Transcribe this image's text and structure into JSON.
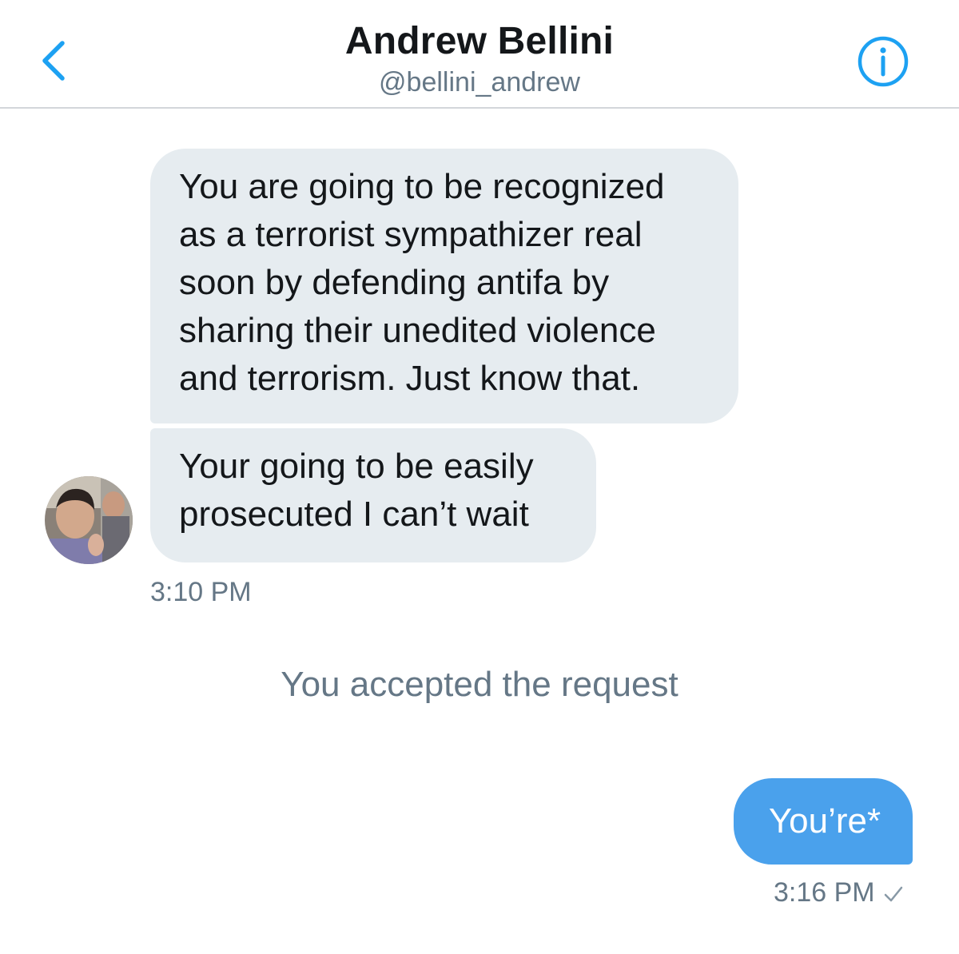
{
  "header": {
    "name": "Andrew Bellini",
    "handle": "@bellini_andrew"
  },
  "messages_in": [
    {
      "text": "You are going to be recognized\nas a terrorist sympathizer real\nsoon by defending antifa by\nsharing their unedited violence\nand terrorism. Just know that."
    },
    {
      "text": "Your going to be easily\nprosecuted I can’t wait"
    }
  ],
  "time_in": "3:10 PM",
  "system_message": "You accepted the request",
  "message_out": {
    "text": "You’re*",
    "time": "3:16 PM"
  },
  "colors": {
    "accent": "#1da1f2",
    "bubble_in": "#e6ecf0",
    "bubble_out": "#4aa1ec",
    "secondary_text": "#657786"
  },
  "icons": {
    "back": "chevron-left-icon",
    "info": "info-icon",
    "sent": "check-icon"
  }
}
